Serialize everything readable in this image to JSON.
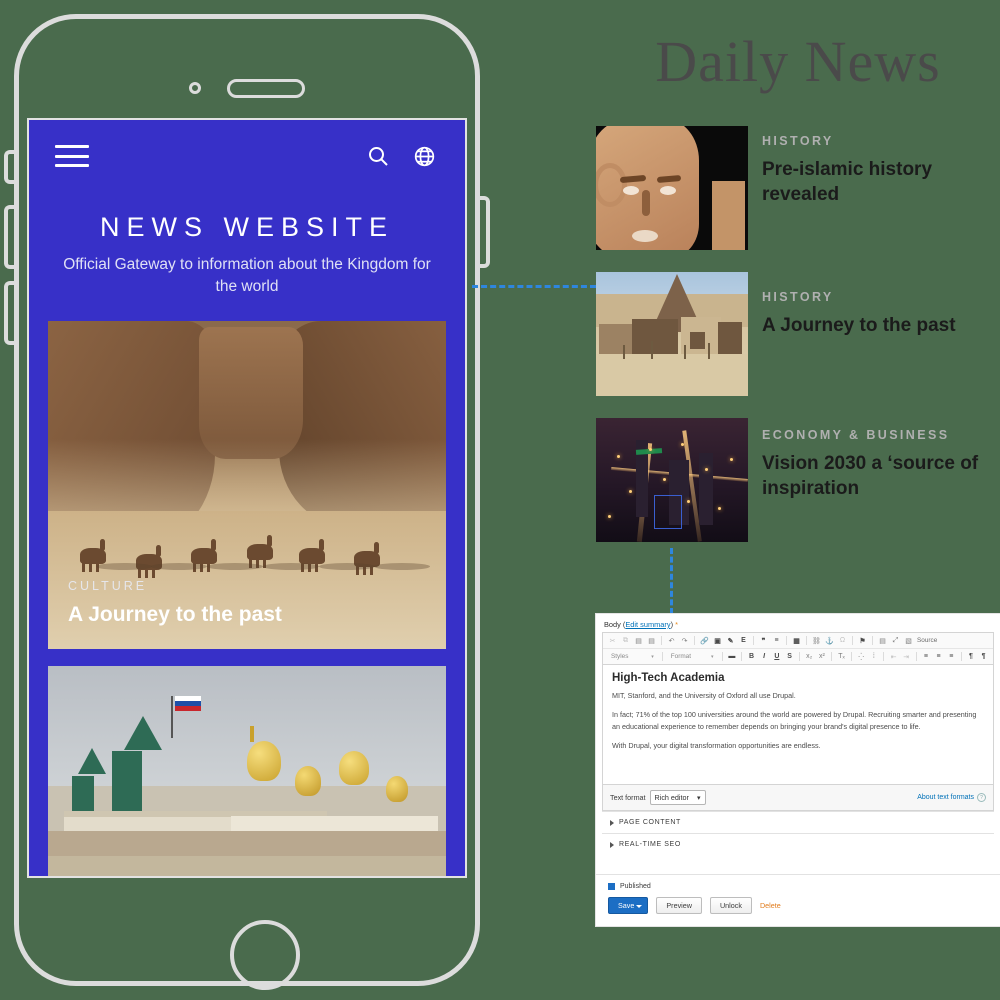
{
  "masthead": {
    "title": "Daily News"
  },
  "phone": {
    "app": {
      "menu_icon": "hamburger-icon",
      "search_icon": "search-icon",
      "language_icon": "globe-icon",
      "title": "NEWS WEBSITE",
      "subtitle": "Official Gateway to information about the Kingdom for the world",
      "hero": {
        "category": "CULTURE",
        "headline": "A Journey to the past",
        "image_alt": "camel riders crossing a desert canyon"
      },
      "second_card": {
        "image_alt": "Kremlin towers and cathedral domes"
      }
    }
  },
  "news_list": {
    "items": [
      {
        "category": "HISTORY",
        "headline": "Pre-islamic history revealed",
        "image_alt": "carved stone face sculpture on black background"
      },
      {
        "category": "HISTORY",
        "headline": "A Journey to the past",
        "image_alt": "mud brick village with conical tower"
      },
      {
        "category": "ECONOMY & BUSINESS",
        "headline": "Vision 2030 a ‘source of inspiration",
        "image_alt": "aerial night view of an illuminated city"
      }
    ]
  },
  "editor": {
    "field_label": "Body",
    "edit_summary_link": "Edit summary",
    "required_mark": "*",
    "toolbar_row1": [
      {
        "name": "cut-icon",
        "glyph": "✂"
      },
      {
        "name": "copy-icon",
        "glyph": "⧉"
      },
      {
        "name": "paste-icon",
        "glyph": "Ὄb"
      },
      {
        "name": "paste-text-icon",
        "glyph": "Ὄb"
      },
      {
        "name": "undo-icon",
        "glyph": "↶"
      },
      {
        "name": "redo-icon",
        "glyph": "↷"
      },
      {
        "name": "link-icon",
        "glyph": "⚭"
      },
      {
        "name": "image-icon",
        "glyph": "Ὓc"
      },
      {
        "name": "media-icon",
        "glyph": "✎"
      },
      {
        "name": "entity-embed-icon",
        "glyph": "E"
      },
      {
        "name": "blockquote-icon",
        "glyph": "”"
      },
      {
        "name": "horizontal-rule-icon",
        "glyph": "≡"
      },
      {
        "name": "table-icon",
        "glyph": "▦"
      },
      {
        "name": "unlink-icon",
        "glyph": "⚭"
      },
      {
        "name": "anchor-icon",
        "glyph": "⚓"
      },
      {
        "name": "special-char-icon",
        "glyph": "Ω"
      },
      {
        "name": "flag-icon",
        "glyph": "⚑"
      },
      {
        "name": "templates-icon",
        "glyph": "▤"
      },
      {
        "name": "maximize-icon",
        "glyph": "⤢"
      },
      {
        "name": "source-icon",
        "glyph": "▧"
      }
    ],
    "toolbar_row1_source_label": "Source",
    "toolbar_row2_styles_label": "Styles",
    "toolbar_row2_format_label": "Format",
    "toolbar_row2": [
      {
        "name": "text-color-icon",
        "glyph": "■"
      },
      {
        "name": "bold-icon",
        "glyph": "B"
      },
      {
        "name": "italic-icon",
        "glyph": "I"
      },
      {
        "name": "underline-icon",
        "glyph": "U"
      },
      {
        "name": "strikethrough-icon",
        "glyph": "S"
      },
      {
        "name": "subscript-icon",
        "glyph": "x₂"
      },
      {
        "name": "superscript-icon",
        "glyph": "x²"
      },
      {
        "name": "remove-format-icon",
        "glyph": "Tₓ"
      },
      {
        "name": "bulleted-list-icon",
        "glyph": "≔"
      },
      {
        "name": "numbered-list-icon",
        "glyph": "∷"
      },
      {
        "name": "outdent-icon",
        "glyph": "⇤"
      },
      {
        "name": "indent-icon",
        "glyph": "⇥"
      },
      {
        "name": "align-left-icon",
        "glyph": "≡"
      },
      {
        "name": "align-center-icon",
        "glyph": "≡"
      },
      {
        "name": "align-right-icon",
        "glyph": "≡"
      },
      {
        "name": "rtl-icon",
        "glyph": "¶"
      },
      {
        "name": "ltr-icon",
        "glyph": "¶"
      }
    ],
    "content": {
      "heading": "High-Tech Academia",
      "paragraphs": [
        "MIT, Stanford, and the University of Oxford all use Drupal.",
        "In fact; 71% of the top 100 universities around the world are powered by Drupal. Recruiting smarter and presenting an educational experience to remember depends on bringing your brand's digital presence to life.",
        "With Drupal, your digital transformation opportunities are endless."
      ]
    },
    "text_format_label": "Text format",
    "text_format_value": "Rich editor",
    "text_format_options": [
      "Rich editor"
    ],
    "about_text_formats": "About text formats",
    "sections": [
      {
        "label": "PAGE CONTENT"
      },
      {
        "label": "REAL-TIME SEO"
      }
    ],
    "published_label": "Published",
    "buttons": {
      "save": "Save",
      "preview": "Preview",
      "unlock": "Unlock",
      "delete": "Delete"
    }
  },
  "colors": {
    "background": "#4a6b4d",
    "phone_frame": "#dcdcdc",
    "app_blue": "#3730c8",
    "connector_blue": "#2e86de",
    "masthead_gray": "#4a4a4a",
    "category_gray": "#b0b0b0",
    "drupal_blue": "#1c6ec4",
    "delete_orange": "#e07b1b"
  }
}
